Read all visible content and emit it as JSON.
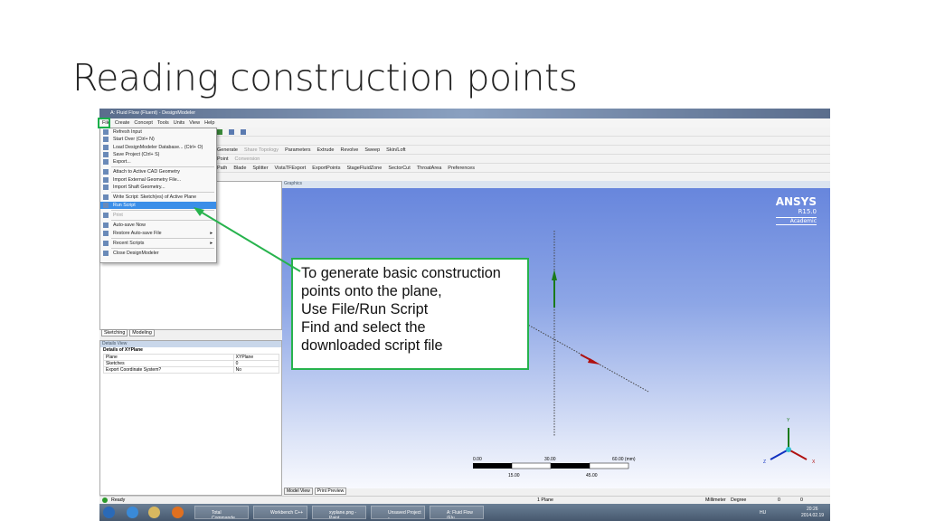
{
  "slide": {
    "title": "Reading construction points"
  },
  "window": {
    "title": "A: Fluid Flow (Fluent) - DesignModeler"
  },
  "menubar": [
    "File",
    "Create",
    "Concept",
    "Tools",
    "Units",
    "View",
    "Help"
  ],
  "toolbar": {
    "row2": [
      "Generate",
      "Share Topology",
      "Parameters",
      "Extrude",
      "Revolve",
      "Sweep",
      "Skin/Loft"
    ],
    "row3": [
      "Point",
      "Conversion"
    ],
    "row4": [
      "Path",
      "Blade",
      "Splitter",
      "VistaTFExport",
      "ExportPoints",
      "StageFluidZone",
      "SectorCut",
      "ThroatArea",
      "Preferences"
    ]
  },
  "file_menu": [
    {
      "label": "Refresh Input"
    },
    {
      "label": "Start Over (Ctrl+ N)"
    },
    {
      "label": "Load DesignModeler Database... (Ctrl+ O)"
    },
    {
      "label": "Save Project (Ctrl+ S)"
    },
    {
      "label": "Export..."
    },
    {
      "label": "Attach to Active CAD Geometry"
    },
    {
      "label": "Import External Geometry File..."
    },
    {
      "label": "Import Shaft Geometry..."
    },
    {
      "label": "Write Script: Sketch(es) of Active Plane"
    },
    {
      "label": "Run Script",
      "selected": true
    },
    {
      "label": "Print",
      "disabled": true
    },
    {
      "label": "Auto-save Now"
    },
    {
      "label": "Restore Auto-save File",
      "submenu": true
    },
    {
      "label": "Recent Scripts",
      "submenu": true
    },
    {
      "label": "Close DesignModeler"
    }
  ],
  "left_tabs": [
    "Sketching",
    "Modeling"
  ],
  "details": {
    "header": "Details View",
    "title": "Details of XYPlane",
    "rows": [
      [
        "Plane",
        "XYPlane"
      ],
      [
        "Sketches",
        "0"
      ],
      [
        "Export Coordinate System?",
        "No"
      ]
    ]
  },
  "graphics": {
    "header": "Graphics",
    "logo": "ANSYS",
    "version": "R15.0",
    "license": "Academic",
    "scale": {
      "top": [
        "0.00",
        "30.00",
        "60.00 (mm)"
      ],
      "bottom": [
        "15.00",
        "45.00"
      ]
    },
    "axes": {
      "y": "Y",
      "x": "X",
      "z": "Z"
    }
  },
  "callout": [
    "To generate basic construction",
    "points onto the plane,",
    "Use File/Run Script",
    "Find and select the",
    "downloaded script file"
  ],
  "view_tabs": [
    "Model View",
    "Print Preview"
  ],
  "status": {
    "text": "Ready",
    "selection": "1 Plane",
    "units": "Millimeter",
    "angle": "Degree",
    "v1": "0",
    "v2": "0"
  },
  "taskbar": {
    "items": [
      "Total Commande...",
      "Workbench C++",
      "xyplane.png - Paint",
      "Unsaved Project -...",
      "A: Fluid Flow (Flu..."
    ],
    "lang": "HU",
    "time": "20:26",
    "date": "2014.02.19"
  },
  "colors": {
    "accent": "#27b34d",
    "selection": "#3b8ee8"
  }
}
